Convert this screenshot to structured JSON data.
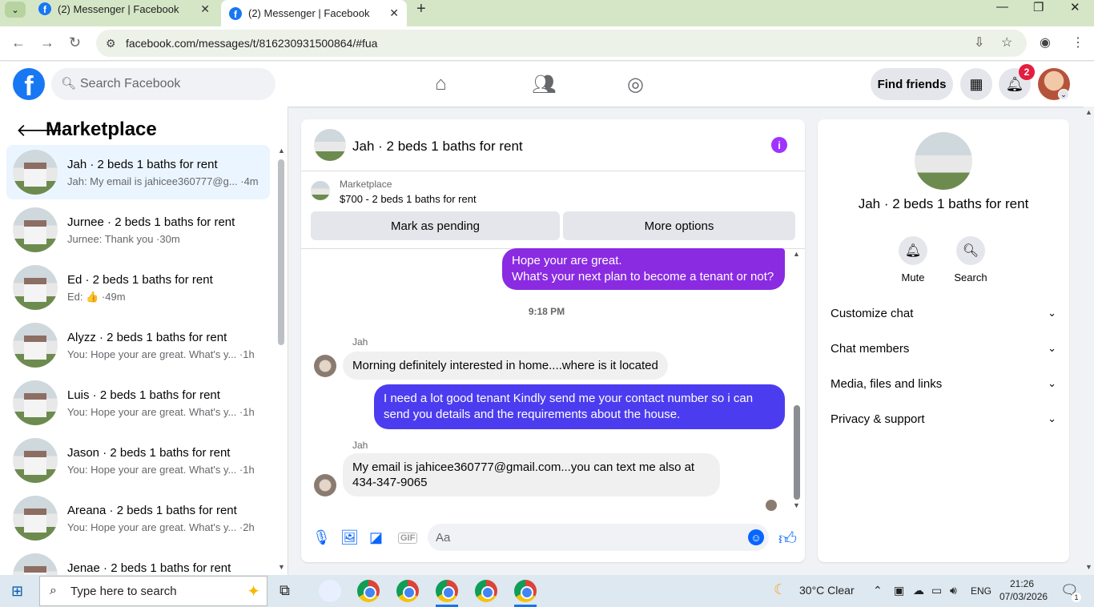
{
  "browser": {
    "tabs": [
      {
        "title": "(2) Messenger | Facebook",
        "active": false
      },
      {
        "title": "(2) Messenger | Facebook",
        "active": true
      }
    ],
    "url": "facebook.com/messages/t/816230931500864/#fua"
  },
  "fb_header": {
    "logo_letter": "f",
    "search_placeholder": "Search Facebook",
    "find_friends": "Find friends",
    "notification_count": "2"
  },
  "left_panel": {
    "title": "Marketplace",
    "conversations": [
      {
        "name": "Jah · 2 beds 1 baths for rent",
        "preview": "Jah: My email is jahicee360777@g... ·4m",
        "selected": true
      },
      {
        "name": "Jurnee · 2 beds 1 baths for rent",
        "preview": "Jurnee: Thank you ·30m"
      },
      {
        "name": "Ed · 2 beds 1 baths for rent",
        "preview": "Ed: 👍 ·49m"
      },
      {
        "name": "Alyzz · 2 beds 1 baths for rent",
        "preview": "You: Hope your are great. What's y... ·1h"
      },
      {
        "name": "Luis · 2 beds 1 baths for rent",
        "preview": "You: Hope your are great. What's y... ·1h"
      },
      {
        "name": "Jason · 2 beds 1 baths for rent",
        "preview": "You: Hope your are great. What's y... ·1h"
      },
      {
        "name": "Areana · 2 beds 1 baths for rent",
        "preview": "You: Hope your are great. What's y... ·2h"
      },
      {
        "name": "Jenae · 2 beds 1 baths for rent",
        "preview": ""
      }
    ]
  },
  "chat": {
    "title": "Jah · 2 beds 1 baths for rent",
    "marketplace_label": "Marketplace",
    "listing": "$700 - 2 beds 1 baths for rent",
    "mark_pending": "Mark as pending",
    "more_options": "More options",
    "msg1_line1": "Hope your are great.",
    "msg1_line2": "What's your next plan to become a tenant or not?",
    "time": "9:18 PM",
    "sender1": "Jah",
    "msg2": "Morning definitely interested in home....where is it located",
    "msg3_line1": "I need a lot good tenant Kindly send me your contact number so i can",
    "msg3_line2": "send you details and the requirements about the house.",
    "sender2": "Jah",
    "msg4_line1": "My email is jahicee360777@gmail.com...you can text me also at",
    "msg4_line2": "434-347-9065",
    "composer_placeholder": "Aa",
    "gif_label": "GIF",
    "info_glyph": "i"
  },
  "right_panel": {
    "title": "Jah · 2 beds 1 baths for rent",
    "mute": "Mute",
    "search": "Search",
    "rows": [
      "Customize chat",
      "Chat members",
      "Media, files and links",
      "Privacy & support"
    ]
  },
  "taskbar": {
    "search_placeholder": "Type here to search",
    "weather": "30°C  Clear",
    "lang": "ENG",
    "time": "21:26",
    "date": "07/03/2026",
    "notif_count": "1"
  },
  "colors": {
    "fb_blue": "#1877f2",
    "purple_bubble": "#8a2be2",
    "blue_bubble": "#4c3cf0",
    "messenger_blue": "#0866ff"
  }
}
